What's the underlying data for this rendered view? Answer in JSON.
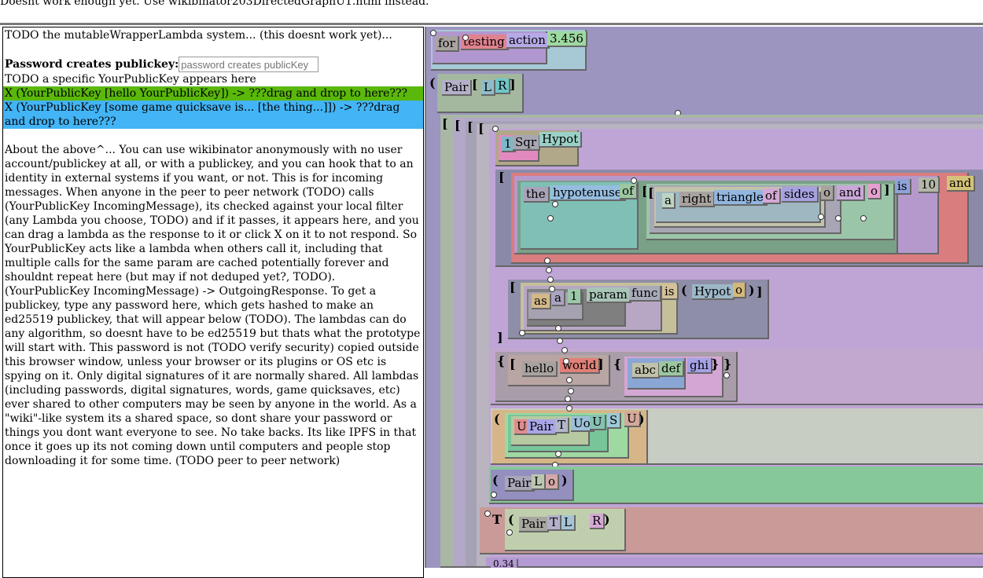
{
  "top_note": "Doesnt work enough yet. Use wikibinator203DirectedGraphU1.html instead.",
  "left": {
    "todo_line": "TODO the mutableWrapperLambda system... (this doesnt work yet)...",
    "password_label": "Password creates publickey:",
    "password_placeholder": "password creates publicKey",
    "pubkey_line": "TODO a specific YourPublicKey appears here",
    "close_glyph": "X",
    "green_row": "(YourPublicKey [hello YourPublicKey]) -> ???drag and drop to here???",
    "blue_row": "(YourPublicKey [some game quicksave is... [the thing...]]) -> ???drag and drop to here???",
    "about": "About the above^... You can use wikibinator anonymously with no user account/publickey at all, or with a publickey, and you can hook that to an identity in external systems if you want, or not. This is for incoming messages. When anyone in the peer to peer network (TODO) calls (YourPublicKey IncomingMessage), its checked against your local filter (any Lambda you choose, TODO) and if it passes, it appears here, and you can drag a lambda as the response to it or click X on it to not respond. So YourPublicKey acts like a lambda when others call it, including that multiple calls for the same param are cached potentially forever and shouldnt repeat here (but may if not deduped yet?, TODO). (YourPublicKey IncomingMessage) -> OutgoingResponse. To get a publickey, type any password here, which gets hashed to make an ed25519 publickey, that will appear below (TODO). The lambdas can do any algorithm, so doesnt have to be ed25519 but thats what the prototype will start with. This password is not (TODO verify security) copied outside this browser window, unless your browser or its plugins or OS etc is spying on it. Only digital signatures of it are normally shared. All lambdas (including passwords, digital signatures, words, game quicksaves, etc) ever shared to other computers may be seen by anyone in the world. As a \"wiki\"-like system its a shared space, so dont share your password or things you dont want everyone to see. No take backs. Its like IPFS in that once it goes up its not coming down until computers and people stop downloading it for some time. (TODO peer to peer network)"
  },
  "graph": {
    "tokens": {
      "for": "for",
      "testing": "testing",
      "action": "action",
      "num": "3.456",
      "pair": "Pair",
      "L": "L",
      "R": "R",
      "T": "T",
      "sqr": "Sqr",
      "hypot": "Hypot",
      "the": "the",
      "hypotenuse": "hypotenuse",
      "of": "of",
      "a": "a",
      "right": "right",
      "triangle": "triangle",
      "sides": "sides",
      "and": "and",
      "is": "is",
      "ten": "10",
      "as": "as",
      "one": "1",
      "param": "param",
      "func": "func",
      "hello": "hello",
      "world": "world",
      "abc": "abc",
      "def": "def",
      "ghi": "ghi",
      "U": "U",
      "S": "S",
      "Uo": "Uo",
      "o": "o",
      "num2": "0.34"
    },
    "brackets": {
      "open_paren": "(",
      "close_paren": ")",
      "open_sq": "[",
      "close_sq": "]",
      "open_curly": "{",
      "close_curly": "}"
    }
  }
}
